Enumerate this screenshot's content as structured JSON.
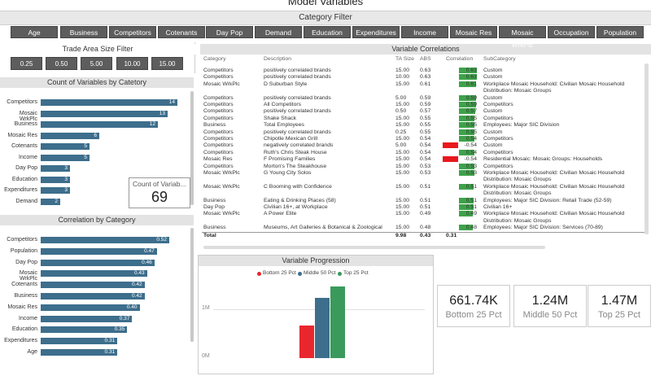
{
  "title": "Model Variables",
  "category_filter": {
    "title": "Category Filter",
    "buttons": [
      "Age",
      "Business",
      "Competitors",
      "Cotenants",
      "Day Pop",
      "Demand",
      "Education",
      "Expenditures",
      "Income",
      "Mosaic Res",
      "Mosaic WrkPlc",
      "Occupation",
      "Population"
    ]
  },
  "trade_area": {
    "title": "Trade Area Size Filter",
    "buttons": [
      "0.25",
      "0.50",
      "5.00",
      "10.00",
      "15.00"
    ]
  },
  "count_chart": {
    "title": "Count of Variables by Catetory",
    "tooltip_label": "Count of Variab...",
    "tooltip_value": "69",
    "chart_data": {
      "type": "bar",
      "categories": [
        "Competitors",
        "Mosaic WrkPlc",
        "Business",
        "Mosaic Res",
        "Cotenants",
        "Income",
        "Day Pop",
        "Education",
        "Expenditures",
        "Demand"
      ],
      "values": [
        14,
        13,
        12,
        6,
        5,
        5,
        3,
        3,
        3,
        2
      ]
    }
  },
  "corr_chart": {
    "title": "Correlation by Category",
    "chart_data": {
      "type": "bar",
      "categories": [
        "Competitors",
        "Population",
        "Day Pop",
        "Mosaic WrkPlc",
        "Cotenants",
        "Business",
        "Mosaic Res",
        "Income",
        "Education",
        "Expenditures",
        "Age"
      ],
      "values": [
        0.52,
        0.47,
        0.46,
        0.43,
        0.42,
        0.42,
        0.4,
        0.37,
        0.35,
        0.31,
        0.31
      ]
    }
  },
  "variable_correlations": {
    "title": "Variable Correlations",
    "headers": [
      "Category",
      "Description",
      "TA Size",
      "ABS",
      "Correlation",
      "SubCategory"
    ],
    "rows": [
      [
        "Competitors",
        "positively correlated brands",
        "15.00",
        "0.63",
        "0.63",
        "Custom"
      ],
      [
        "Competitors",
        "positively correlated brands",
        "10.00",
        "0.63",
        "0.63",
        "Custom"
      ],
      [
        "Mosaic WrkPlc",
        "D Suburban Style",
        "15.00",
        "0.61",
        "0.61",
        "Workplace Mosaic Household: Civilian Mosaic Household"
      ],
      [
        "",
        "",
        "",
        "",
        "",
        "Distribution: Mosaic Groups"
      ],
      [
        "Competitors",
        "positively correlated brands",
        "5.00",
        "0.59",
        "0.59",
        "Custom"
      ],
      [
        "Competitors",
        "All Competitors",
        "15.00",
        "0.59",
        "0.59",
        "Competitors"
      ],
      [
        "Competitors",
        "positively correlated brands",
        "0.50",
        "0.57",
        "0.57",
        "Custom"
      ],
      [
        "Competitors",
        "Shake Shack",
        "15.00",
        "0.55",
        "0.55",
        "Competitors"
      ],
      [
        "Business",
        "Total Employees",
        "15.00",
        "0.55",
        "0.55",
        "Employees: Major SIC Division"
      ],
      [
        "Competitors",
        "positively correlated brands",
        "0.25",
        "0.55",
        "0.55",
        "Custom"
      ],
      [
        "Competitors",
        "Chipotle Mexican Grill",
        "15.00",
        "0.54",
        "0.54",
        "Competitors"
      ],
      [
        "Competitors",
        "negatively correlated brands",
        "5.00",
        "0.54",
        "-0.54",
        "Custom"
      ],
      [
        "Competitors",
        "Ruth's Chris Steak House",
        "15.00",
        "0.54",
        "0.54",
        "Competitors"
      ],
      [
        "Mosaic Res",
        "F Promising Families",
        "15.00",
        "0.54",
        "-0.54",
        "Residential Mosaic: Mosaic Groups: Households"
      ],
      [
        "Competitors",
        "Morton's The Steakhouse",
        "15.00",
        "0.53",
        "0.53",
        "Competitors"
      ],
      [
        "Mosaic WrkPlc",
        "G Young City Solos",
        "15.00",
        "0.53",
        "0.53",
        "Workplace Mosaic Household: Civilian Mosaic Household"
      ],
      [
        "",
        "",
        "",
        "",
        "",
        "Distribution: Mosaic Groups"
      ],
      [
        "Mosaic WrkPlc",
        "C Booming with Confidence",
        "15.00",
        "0.51",
        "0.51",
        "Workplace Mosaic Household: Civilian Mosaic Household"
      ],
      [
        "",
        "",
        "",
        "",
        "",
        "Distribution: Mosaic Groups"
      ],
      [
        "Business",
        "Eating & Drinking Places (58)",
        "15.00",
        "0.51",
        "0.51",
        "Employees: Major SIC Division: Retail Trade (52-59)"
      ],
      [
        "Day Pop",
        "Civilian 16+, at Workplace",
        "15.00",
        "0.51",
        "0.51",
        "Civilian 16+"
      ],
      [
        "Mosaic WrkPlc",
        "A Power Elite",
        "15.00",
        "0.49",
        "0.49",
        "Workplace Mosaic Household: Civilian Mosaic Household"
      ],
      [
        "",
        "",
        "",
        "",
        "",
        "Distribution: Mosaic Groups"
      ],
      [
        "Business",
        "Museums, Art Galleries & Botanical & Zoological",
        "15.00",
        "0.48",
        "0.48",
        "Employees: Major SIC Division: Services (70-89)"
      ]
    ],
    "total": [
      "Total",
      "",
      "9.98",
      "0.43",
      "0.31",
      ""
    ]
  },
  "progression": {
    "title": "Variable Progression",
    "legend": [
      "Bottom 25 Pct",
      "Middle 50 Pct",
      "Top 25 Pct"
    ],
    "colors": [
      "#e8262e",
      "#3d6e8c",
      "#3a9a5c"
    ],
    "chart_data": {
      "type": "bar",
      "categories": [
        "Bottom 25 Pct",
        "Middle 50 Pct",
        "Top 25 Pct"
      ],
      "values": [
        0.66,
        1.24,
        1.47
      ],
      "yticks": [
        "1M",
        "0M"
      ]
    }
  },
  "kpis": [
    {
      "value": "661.74K",
      "label": "Bottom 25 Pct"
    },
    {
      "value": "1.24M",
      "label": "Middle 50 Pct"
    },
    {
      "value": "1.47M",
      "label": "Top 25 Pct"
    }
  ]
}
